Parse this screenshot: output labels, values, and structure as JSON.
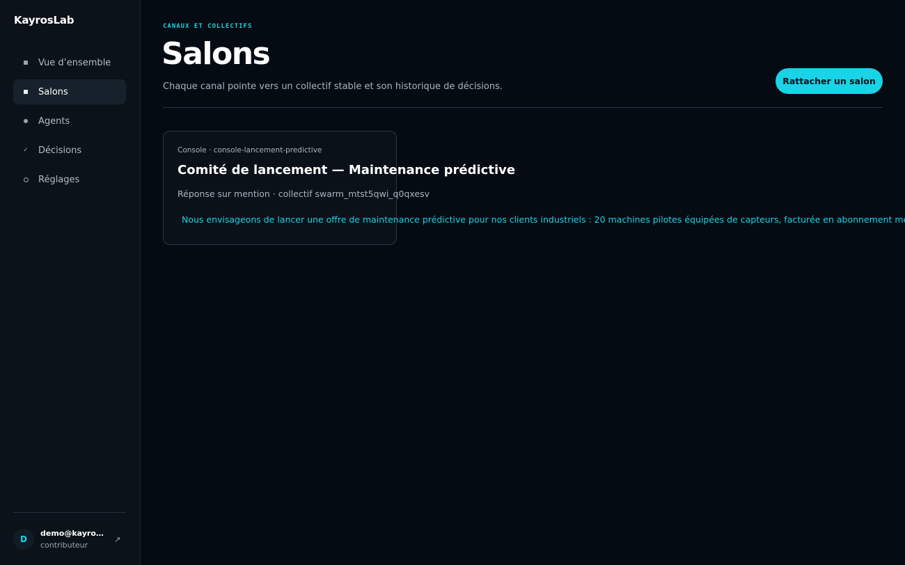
{
  "sidebar": {
    "brand": "KayrosLab",
    "items": [
      {
        "label": "Vue d’ensemble",
        "icon": "square-icon"
      },
      {
        "label": "Salons",
        "icon": "square-icon",
        "active": true
      },
      {
        "label": "Agents",
        "icon": "dot-icon"
      },
      {
        "label": "Décisions",
        "icon": "check-icon"
      },
      {
        "label": "Réglages",
        "icon": "ring-icon"
      }
    ],
    "user": {
      "initial": "D",
      "email": "demo@kayroslab.io",
      "role": "contributeur",
      "link_icon": "↗"
    },
    "check_glyph": "✓"
  },
  "header": {
    "eyebrow": "CANAUX ET COLLECTIFS",
    "title": "Salons",
    "subtitle": "Chaque canal pointe vers un collectif stable et son historique de décisions.",
    "action_label": "Rattacher un salon"
  },
  "rooms": [
    {
      "meta": "Console · console-lancement-predictive",
      "title": "Comité de lancement — Maintenance prédictive",
      "subtitle": "Réponse sur mention · collectif swarm_mtst5qwi_q0qxesv",
      "preview": "Nous envisageons de lancer une offre de maintenance prédictive pour nos clients industriels : 20 machines pilotes équipées de capteurs, facturée en abonnement mensuel par ma"
    }
  ],
  "colors": {
    "accent": "#19d3e6",
    "background": "#050b12",
    "sidebar": "#0c1219"
  }
}
